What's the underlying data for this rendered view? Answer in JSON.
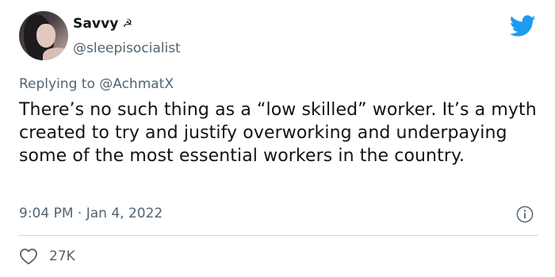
{
  "author": {
    "display_name": "Savvy",
    "name_emoji": "☭",
    "handle": "@sleepisocialist"
  },
  "reply": {
    "prefix": "Replying to",
    "to_handle": "@AchmatX"
  },
  "tweet": {
    "text": "There’s no such thing as a “low skilled” worker. It’s a myth created to try and justify overworking and underpaying some of the most essential workers in the country.",
    "time": "9:04 PM",
    "separator": " · ",
    "date": "Jan 4, 2022"
  },
  "engagement": {
    "likes": "27K"
  },
  "colors": {
    "text": "#0f1419",
    "secondary": "#536471",
    "brand": "#1d9bf0",
    "divider": "#cfd9de"
  },
  "icons": {
    "brand": "twitter-bird-icon",
    "info": "info-icon",
    "like": "heart-icon"
  }
}
